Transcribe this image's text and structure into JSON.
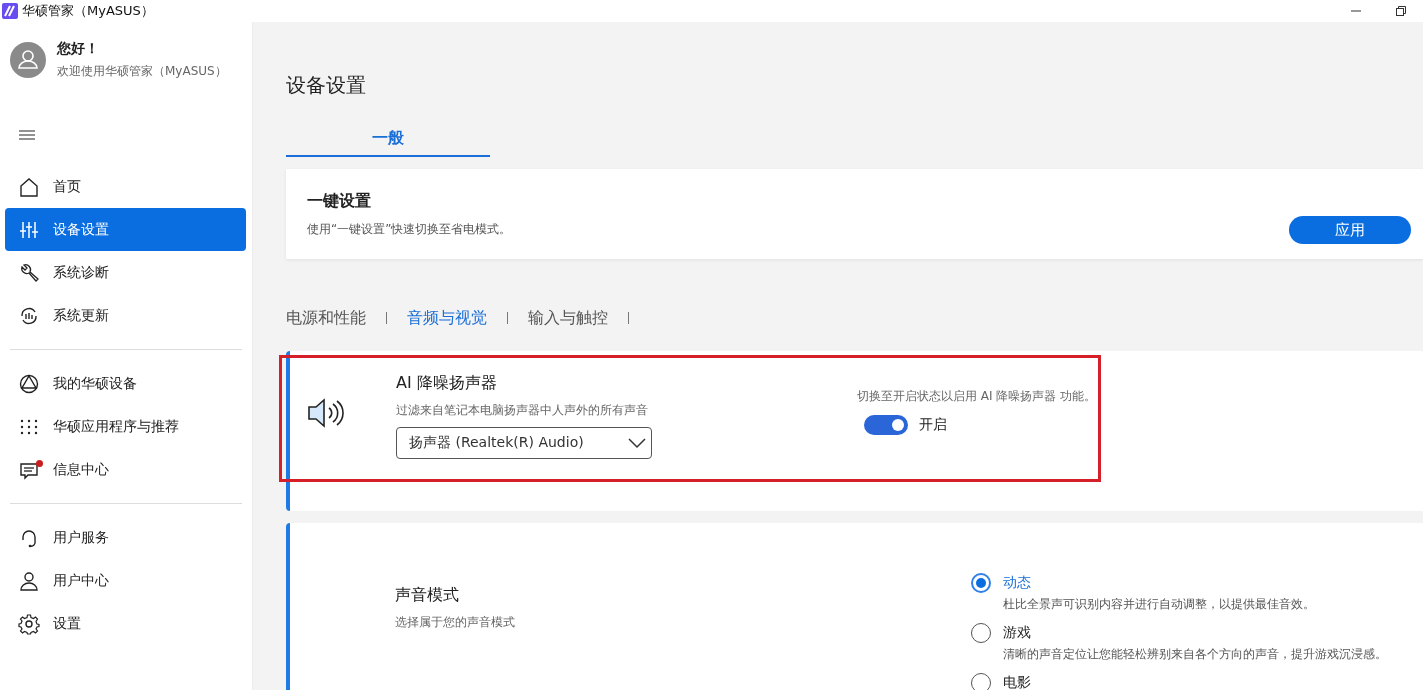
{
  "window": {
    "title": "华硕管家（MyASUS）"
  },
  "profile": {
    "greeting": "您好！",
    "subtitle": "欢迎使用华硕管家（MyASUS）"
  },
  "sidebar": {
    "groups": [
      [
        {
          "kind": "home",
          "label": "首页",
          "selected": false
        },
        {
          "kind": "sliders",
          "label": "设备设置",
          "selected": true
        },
        {
          "kind": "wrench",
          "label": "系统诊断",
          "selected": false
        },
        {
          "kind": "update",
          "label": "系统更新",
          "selected": false
        }
      ],
      [
        {
          "kind": "device",
          "label": "我的华硕设备",
          "selected": false
        },
        {
          "kind": "apps",
          "label": "华硕应用程序与推荐",
          "selected": false
        },
        {
          "kind": "message",
          "label": "信息中心",
          "selected": false,
          "badge": true
        }
      ],
      [
        {
          "kind": "support",
          "label": "用户服务",
          "selected": false
        },
        {
          "kind": "user",
          "label": "用户中心",
          "selected": false
        },
        {
          "kind": "gear",
          "label": "设置",
          "selected": false
        }
      ]
    ]
  },
  "page": {
    "title": "设备设置",
    "tabs": [
      {
        "label": "一般",
        "selected": true
      }
    ]
  },
  "quick_card": {
    "title": "一键设置",
    "description": "使用“一键设置”快速切换至省电模式。",
    "button": "应用"
  },
  "categories": [
    {
      "label": "电源和性能",
      "selected": false
    },
    {
      "label": "音频与视觉",
      "selected": true
    },
    {
      "label": "输入与触控",
      "selected": false
    }
  ],
  "ai_speaker": {
    "title": "AI 降噪扬声器",
    "description": "过滤来自笔记本电脑扬声器中人声外的所有声音",
    "device": "扬声器 (Realtek(R) Audio)",
    "hint": "切换至开启状态以启用 AI 降噪扬声器 功能。",
    "toggle": {
      "on": true,
      "label": "开启"
    }
  },
  "sound_mode": {
    "title": "声音模式",
    "description": "选择属于您的声音模式",
    "options": [
      {
        "label": "动态",
        "description": "杜比全景声可识别内容并进行自动调整，以提供最佳音效。",
        "selected": true
      },
      {
        "label": "游戏",
        "description": "清晰的声音定位让您能轻松辨别来自各个方向的声音，提升游戏沉浸感。",
        "selected": false
      },
      {
        "label": "电影",
        "selected": false
      }
    ]
  }
}
